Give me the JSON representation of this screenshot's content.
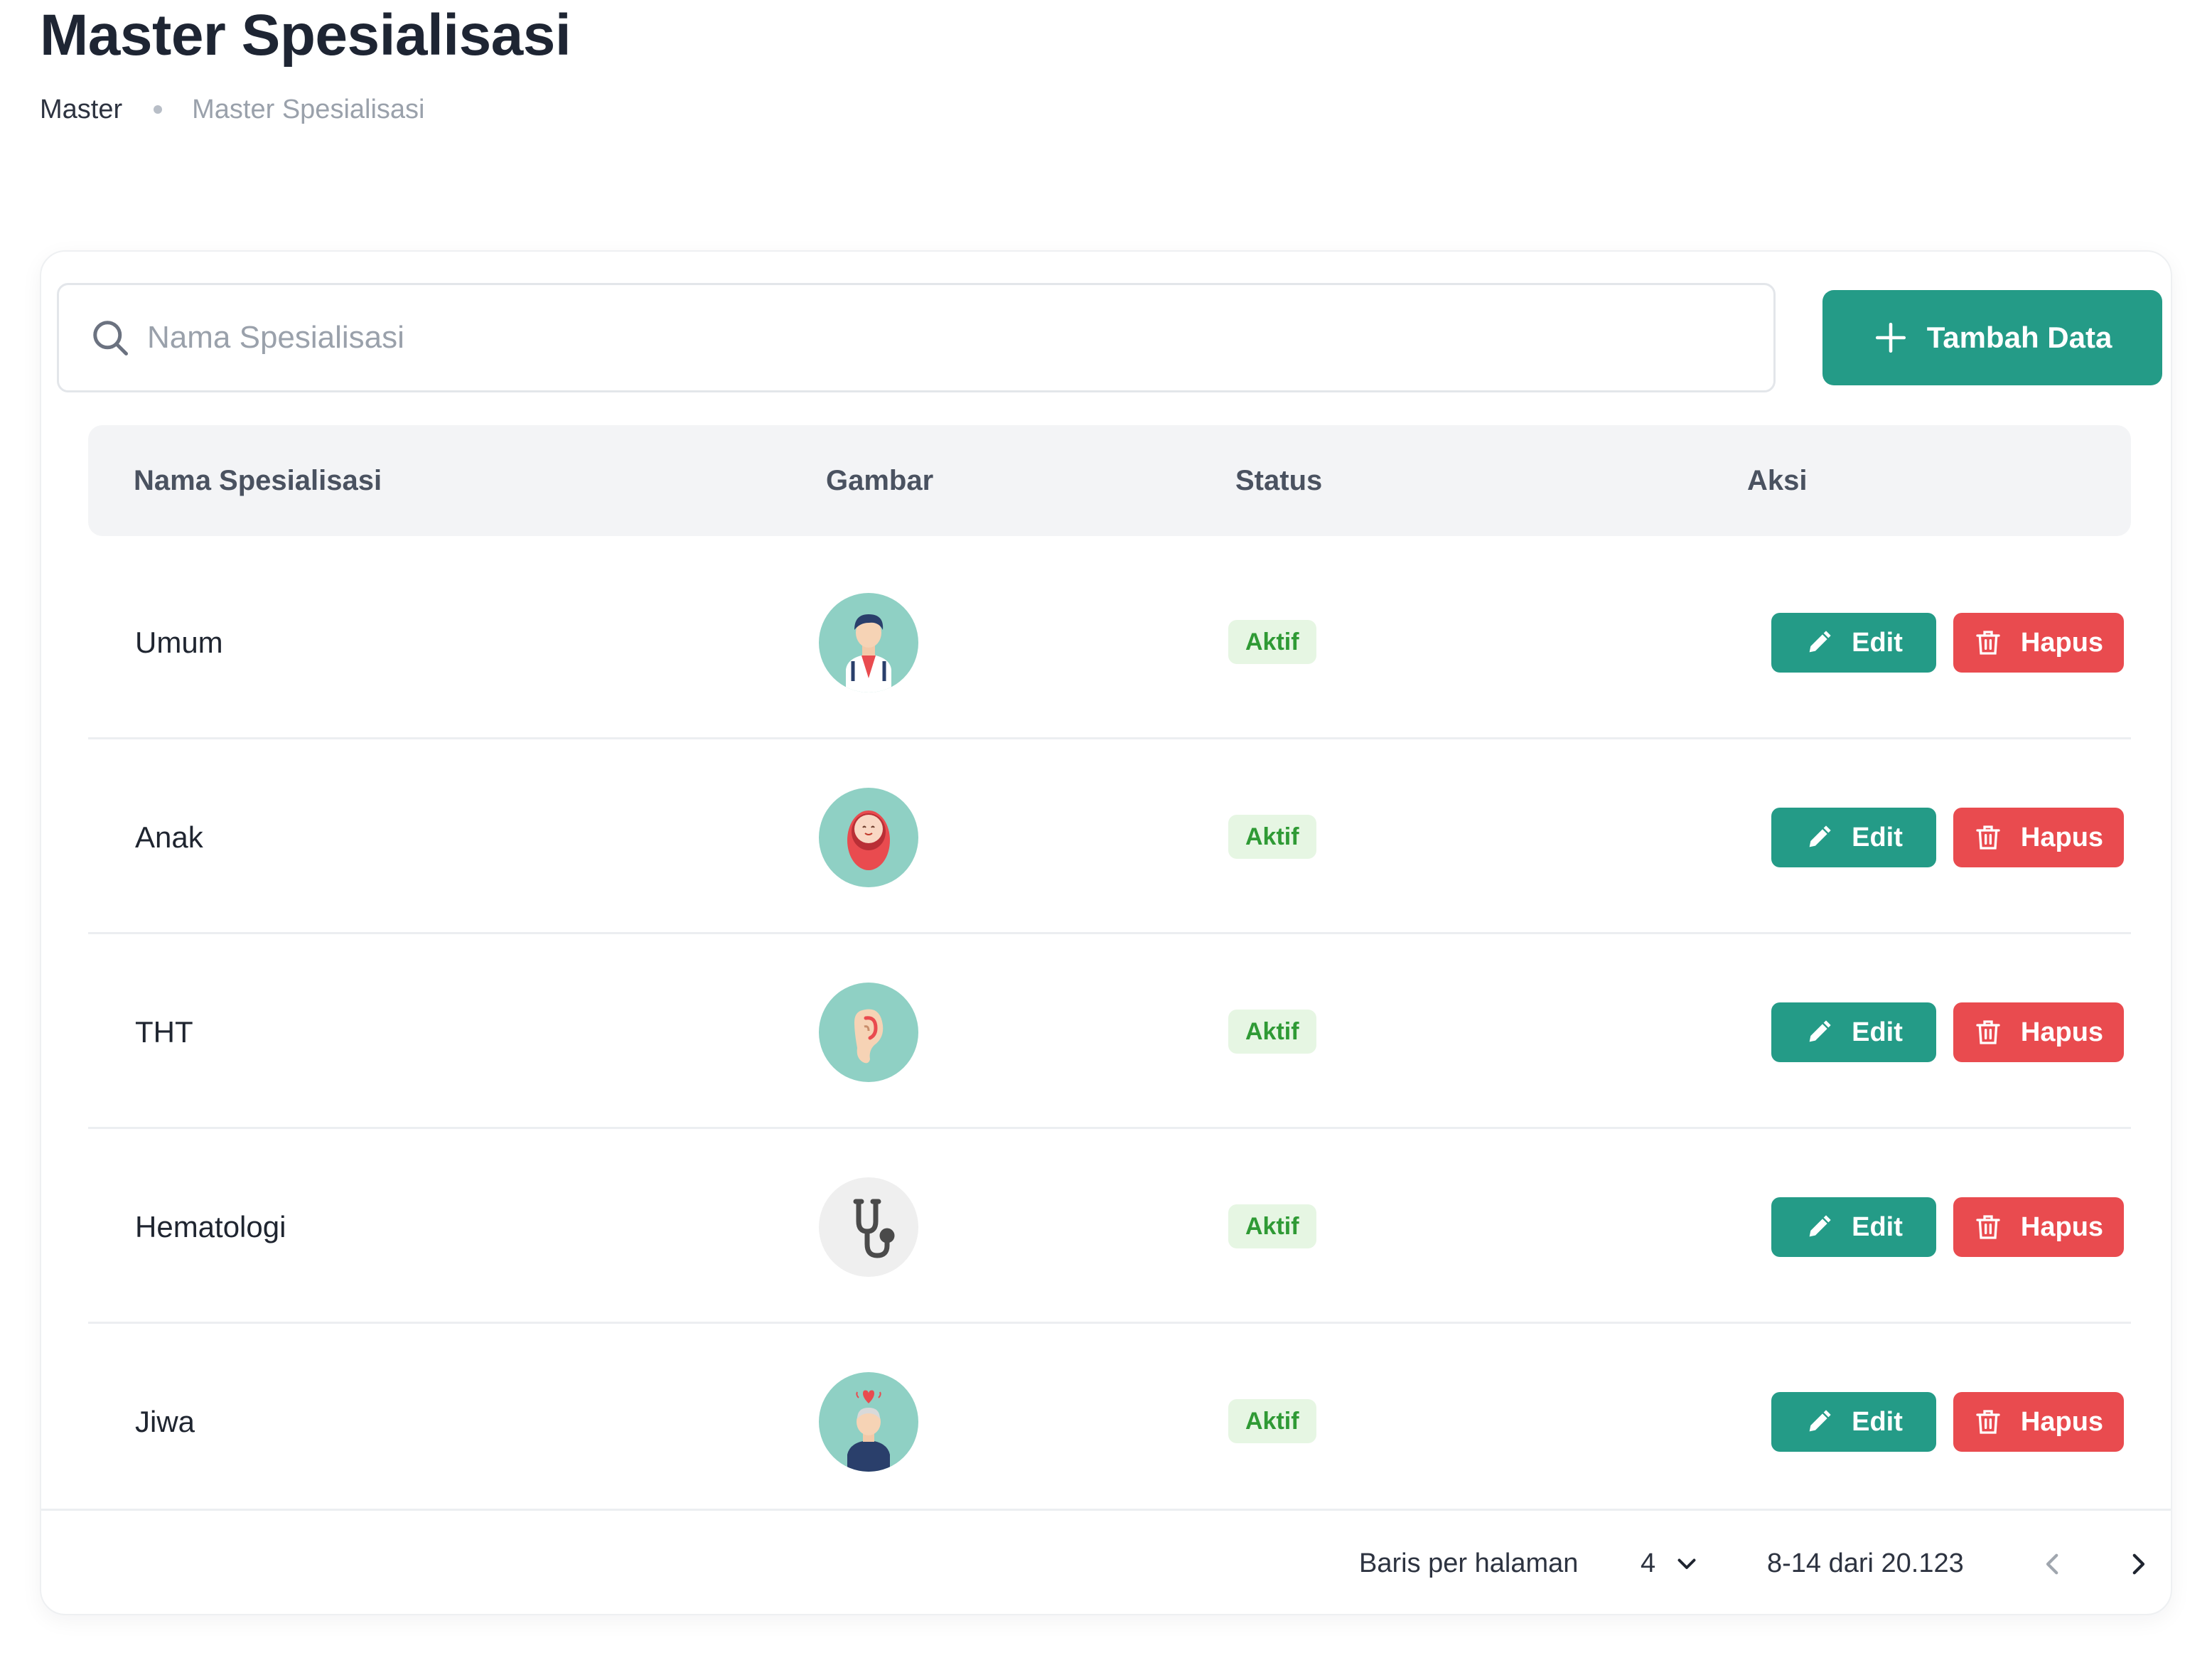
{
  "header": {
    "title": "Master Spesialisasi",
    "breadcrumb": {
      "root": "Master",
      "current": "Master Spesialisasi"
    }
  },
  "toolbar": {
    "search_placeholder": "Nama Spesialisasi",
    "search_value": "",
    "add_label": "Tambah Data"
  },
  "table": {
    "columns": {
      "name": "Nama Spesialisasi",
      "image": "Gambar",
      "status": "Status",
      "action": "Aksi"
    },
    "rows": [
      {
        "name": "Umum",
        "icon": "doctor-icon",
        "status": "Aktif"
      },
      {
        "name": "Anak",
        "icon": "baby-icon",
        "status": "Aktif"
      },
      {
        "name": "THT",
        "icon": "ear-icon",
        "status": "Aktif"
      },
      {
        "name": "Hematologi",
        "icon": "stethoscope-icon",
        "status": "Aktif"
      },
      {
        "name": "Jiwa",
        "icon": "mind-icon",
        "status": "Aktif"
      }
    ],
    "edit_label": "Edit",
    "delete_label": "Hapus"
  },
  "pagination": {
    "rows_per_page_label": "Baris per halaman",
    "rows_per_page_value": "4",
    "range_text": "8-14 dari 20.123"
  },
  "colors": {
    "primary": "#249b87",
    "danger": "#e94b4f",
    "badge_bg": "#e6f6e3",
    "badge_text": "#2f9a35",
    "avatar_bg": "#8fd0c4"
  }
}
